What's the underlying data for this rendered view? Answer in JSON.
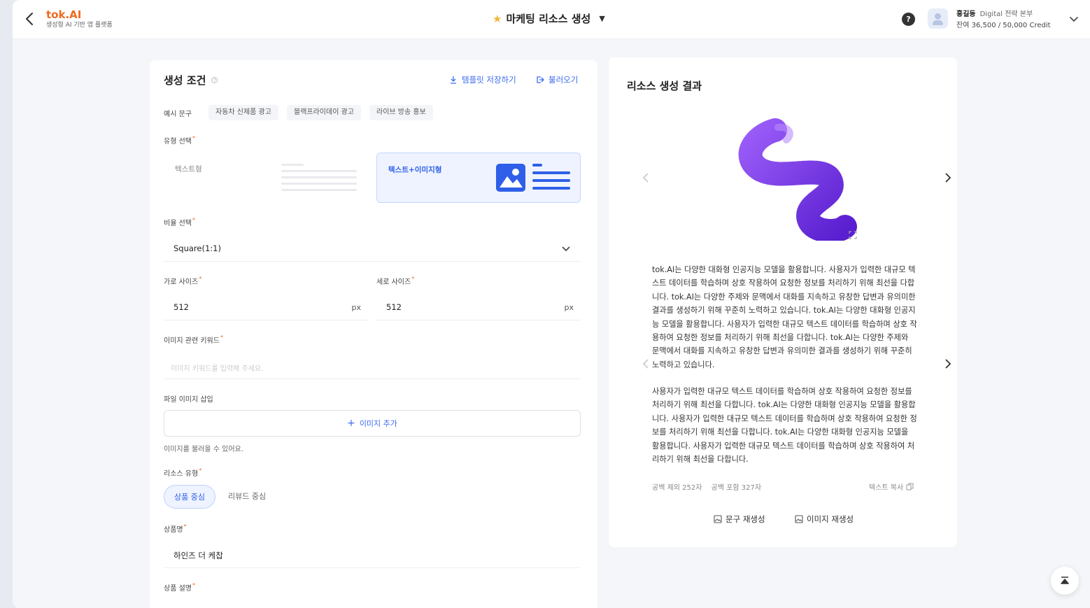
{
  "app": {
    "name": "tok.AI",
    "subtitle": "생성형 AI 기반 앱 플랫폼"
  },
  "header": {
    "title": "마케팅 리소스 생성",
    "user_name": "홍길동",
    "department": "Digital 전략 본부",
    "credit": "잔여 36,500 / 50,000 Credit"
  },
  "form": {
    "section_title": "생성 조건",
    "save_template": "템플릿 저장하기",
    "load": "불러오기",
    "example_label": "예시 문구",
    "examples": [
      "자동차 신제품 광고",
      "블랙프라이데이 광고",
      "라이브 방송 홍보"
    ],
    "type_label": "유형 선택",
    "type_text": "텍스트형",
    "type_text_image": "텍스트+이미지형",
    "ratio_label": "비율 선택",
    "ratio_value": "Square(1:1)",
    "width_label": "가로 사이즈",
    "width_value": "512",
    "height_label": "세로 사이즈",
    "height_value": "512",
    "unit": "px",
    "keyword_label": "이미지 관련 키워드",
    "keyword_placeholder": "이미지 키워드를 입력해 주세요.",
    "file_label": "파일 이미지 삽입",
    "add_image": "이미지 추가",
    "file_hint": "이미지를 불러올 수 있어요.",
    "resource_label": "리소스 유형",
    "resource_product": "상품 중심",
    "resource_review": "리뷰드 중심",
    "product_name_label": "상품명",
    "product_name_value": "하인즈 더 케찹",
    "product_desc_label": "상품 설명"
  },
  "result": {
    "title": "리소스 생성 결과",
    "paragraph1": "tok.AI는 다양한 대화형 인공지능 모델을 활용합니다. 사용자가 입력한 대규모 텍스트 데이터를 학습하며 상호 작용하여 요청한 정보를 처리하기 위해 최선을 다합니다. tok.AI는 다양한 주제와 문맥에서 대화를 지속하고 유창한 답변과 유의미한 결과를 생성하기 위해 꾸준히 노력하고 있습니다. tok.AI는 다양한 대화형 인공지능 모델을 활용합니다. 사용자가 입력한 대규모 텍스트 데이터를 학습하며 상호 작용하여 요청한 정보를 처리하기 위해 최선을 다합니다. tok.AI는 다양한 주제와 문맥에서 대화를 지속하고 유창한 답변과 유의미한 결과를 생성하기 위해 꾸준히 노력하고 있습니다.",
    "paragraph2": "사용자가 입력한 대규모 텍스트 데이터를 학습하며 상호 작용하여 요청한 정보를 처리하기 위해 최선을 다합니다. tok.AI는 다양한 대화형 인공지능 모델을 활용합니다. 사용자가 입력한 대규모 텍스트 데이터를 학습하며 상호 작용하여 요청한 정보를 처리하기 위해 최선을 다합니다. tok.AI는 다양한 대화형 인공지능 모델을 활용합니다. 사용자가 입력한 대규모 텍스트 데이터를 학습하며 상호 작용하여 처리하기 위해 최선을 다합니다.",
    "count_excl": "공백 제외 252자",
    "count_incl": "공백 포함 327자",
    "copy_text": "텍스트 복사",
    "regen_text": "문구 재생성",
    "regen_image": "이미지 재생성"
  },
  "colors": {
    "brand": "#ef6a1f",
    "accent": "#2f5fe8",
    "ribbon": "#7a3cf0"
  }
}
